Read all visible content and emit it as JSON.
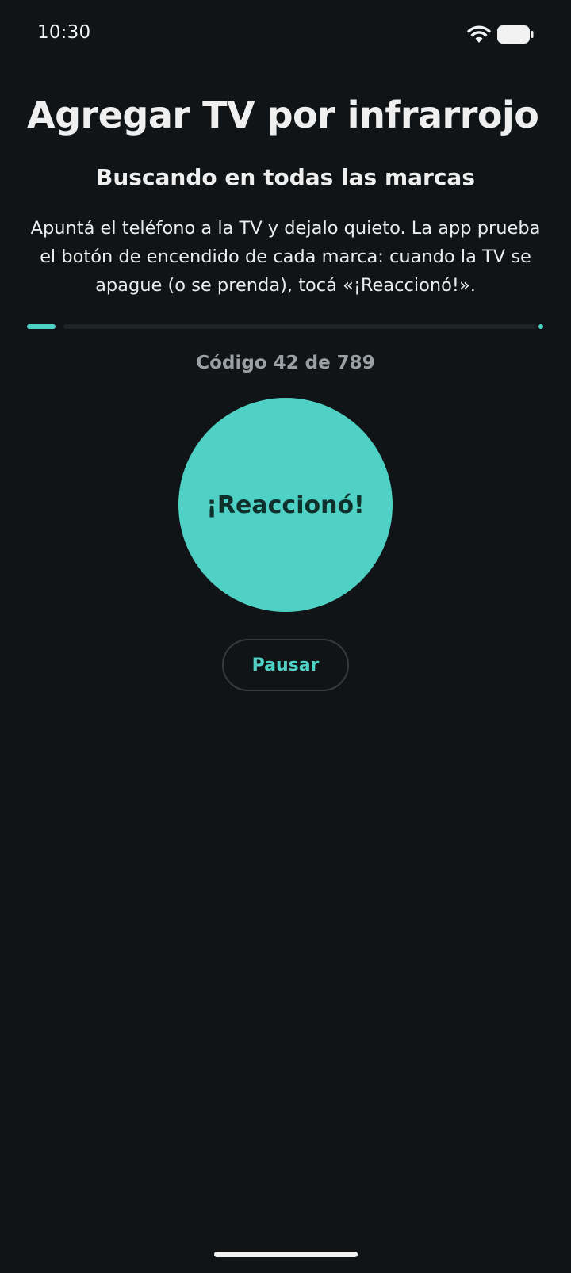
{
  "status_bar": {
    "time": "10:30",
    "icons": [
      "wifi-icon",
      "battery-icon"
    ]
  },
  "header": {
    "title": "Agregar TV por infrarrojo",
    "subtitle": "Buscando en todas las marcas"
  },
  "instructions": "Apuntá el teléfono a la TV y dejalo quieto. La app prueba el botón de encendido de cada marca: cuando la TV se apague (o se prenda), tocá «¡Reaccionó!».",
  "progress": {
    "current": 42,
    "total": 789,
    "fraction": 0.053,
    "label": "Código 42 de 789"
  },
  "actions": {
    "react_label": "¡Reaccionó!",
    "pause_label": "Pausar"
  },
  "colors": {
    "background": "#111416",
    "accent": "#4FD1C5",
    "accent_text": "#10302C",
    "muted_text": "#9AA0A3",
    "track": "#1E2326"
  }
}
